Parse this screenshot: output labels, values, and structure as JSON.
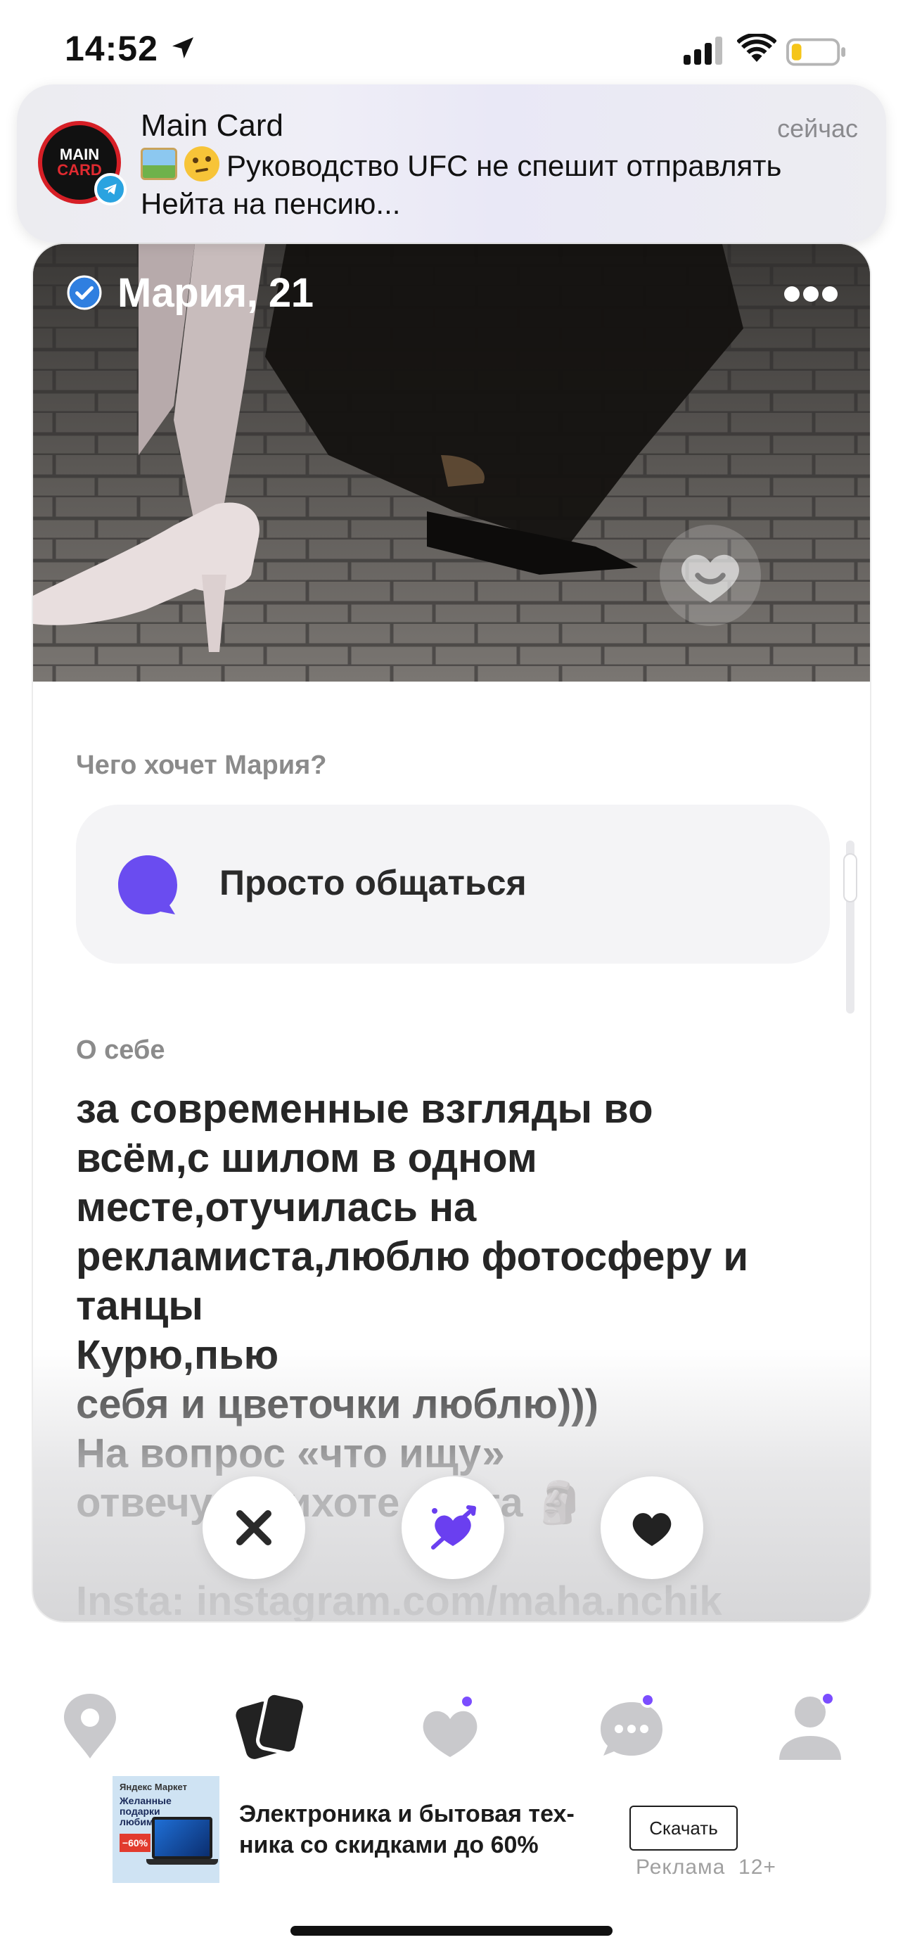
{
  "status_bar": {
    "time": "14:52",
    "icons": [
      "location-arrow-icon",
      "cellular-signal-icon",
      "wifi-icon",
      "battery-low-icon"
    ]
  },
  "notification": {
    "app_name": "Main Card",
    "time": "сейчас",
    "message": "Руководство UFC не спешит отправлять Нейта на пенсию...",
    "avatar_text_top": "MAIN",
    "avatar_text_bottom": "CARD",
    "emojis": [
      "framed-picture-emoji",
      "thinking-face-emoji"
    ]
  },
  "profile": {
    "name_age": "Мария, 21",
    "goal_label": "Чего хочет Мария?",
    "goal_value": "Просто общаться",
    "about_label": "О себе",
    "about_text": "за современные взгляды во\nвсём,с шилом в одном\nместе,отучилась на\nрекламиста,люблю фотосферу и\nтанцы\nКурю,пью\nсебя и цветочки люблю)))\nНа вопрос «что ищу»\nотвечу: прихоте света 🗿\n\nInsta: instagram.com/maha.nchik"
  },
  "actions": [
    {
      "name": "dislike-button",
      "icon": "close-icon"
    },
    {
      "name": "superlike-button",
      "icon": "heart-arrow-icon"
    },
    {
      "name": "like-button",
      "icon": "heart-icon"
    }
  ],
  "tabs": [
    {
      "name": "tab-nearby",
      "icon": "map-pin-icon",
      "active": false,
      "badge": false
    },
    {
      "name": "tab-cards",
      "icon": "cards-icon",
      "active": true,
      "badge": false
    },
    {
      "name": "tab-likes",
      "icon": "likes-heart-icon",
      "active": false,
      "badge": true
    },
    {
      "name": "tab-chats",
      "icon": "chat-bubble-icon",
      "active": false,
      "badge": true
    },
    {
      "name": "tab-profile",
      "icon": "user-icon",
      "active": false,
      "badge": true
    }
  ],
  "ad": {
    "brand": "Яндекс Маркет",
    "image_headline": "Желанные подарки любимым",
    "image_badge": "−60%",
    "text": "Электроника и бытовая тех-\nника со скидками до 60%",
    "button": "Скачать",
    "label": "Реклама  12+"
  },
  "colors": {
    "accent": "#7b4dff",
    "verified": "#2f7fe0",
    "text_primary": "#262626",
    "text_secondary": "#8b8b8b",
    "goal_bg": "#f4f4f6"
  }
}
